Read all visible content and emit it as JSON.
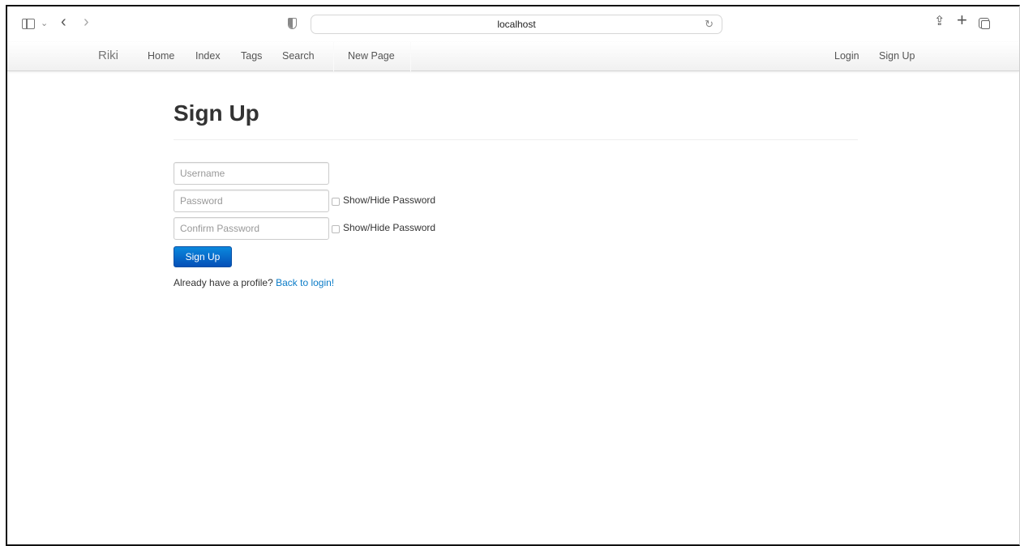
{
  "browser": {
    "url": "localhost"
  },
  "navbar": {
    "brand": "Riki",
    "left_items": [
      "Home",
      "Index",
      "Tags",
      "Search",
      "New Page"
    ],
    "right_items": [
      "Login",
      "Sign Up"
    ]
  },
  "main": {
    "title": "Sign Up",
    "username_placeholder": "Username",
    "password_placeholder": "Password",
    "confirm_placeholder": "Confirm Password",
    "toggle_label": "Show/Hide Password",
    "submit_label": "Sign Up",
    "profile_prompt": "Already have a profile?",
    "login_link": "Back to login!"
  }
}
